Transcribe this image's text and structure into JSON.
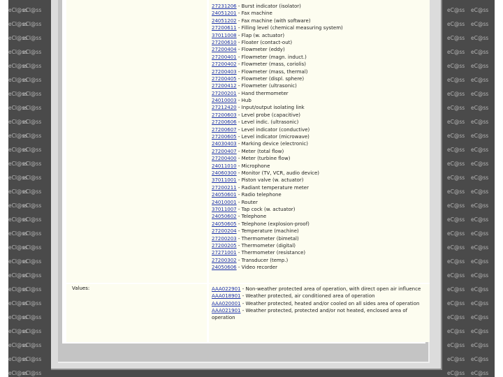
{
  "watermark_left": "eCl@ss",
  "watermark_right": "eC@ss",
  "colors": {
    "background": "#4a4a4a",
    "link": "#1a2fa8",
    "cell": "#fdfdf0"
  },
  "table": {
    "values_label": "Values:",
    "objects": [
      {
        "code": "27231206",
        "text": "Burst indicator (isolator)"
      },
      {
        "code": "24051201",
        "text": "Fax machine"
      },
      {
        "code": "24051202",
        "text": "Fax machine (with software)"
      },
      {
        "code": "27200611",
        "text": "Filling level (chemical measuring system)"
      },
      {
        "code": "37011008",
        "text": "Flap (w. actuator)"
      },
      {
        "code": "27200610",
        "text": "Floater (contact-out)"
      },
      {
        "code": "27200404",
        "text": "Flowmeter (eddy)"
      },
      {
        "code": "27200401",
        "text": "Flowmeter (magn. induct.)"
      },
      {
        "code": "27200402",
        "text": "Flowmeter (mass, coriolis)"
      },
      {
        "code": "27200403",
        "text": "Flowmeter (mass, thermal)"
      },
      {
        "code": "27200405",
        "text": "Flowmeter (displ. sphere)"
      },
      {
        "code": "27200412",
        "text": "Flowmeter (ultrasonic)"
      },
      {
        "code": "27200201",
        "text": "Hand thermometer"
      },
      {
        "code": "24010003",
        "text": "Hub"
      },
      {
        "code": "27212420",
        "text": "Input/output isolating link"
      },
      {
        "code": "27200603",
        "text": "Level probe (capacitive)"
      },
      {
        "code": "27200606",
        "text": "Level indic. (ultrasonic)"
      },
      {
        "code": "27200607",
        "text": "Level indicator (conductive)"
      },
      {
        "code": "27200605",
        "text": "Level indicator (microwave)"
      },
      {
        "code": "24030403",
        "text": "Marking device (electronic)"
      },
      {
        "code": "27200407",
        "text": "Meter (total flow)"
      },
      {
        "code": "27200400",
        "text": "Meter (turbine flow)"
      },
      {
        "code": "24011010",
        "text": "Microphone"
      },
      {
        "code": "24060300",
        "text": "Monitor (TV, VCR, audio device)"
      },
      {
        "code": "37011001",
        "text": "Piston valve (w. actuator)"
      },
      {
        "code": "27200211",
        "text": "Radiant temperature meter"
      },
      {
        "code": "24050601",
        "text": "Radio telephone"
      },
      {
        "code": "24010001",
        "text": "Router"
      },
      {
        "code": "37011007",
        "text": "Tap cock (w. actuator)"
      },
      {
        "code": "24050602",
        "text": "Telephone"
      },
      {
        "code": "24050605",
        "text": "Telephone (explosion-proof)"
      },
      {
        "code": "27200204",
        "text": "Temperature (machine)"
      },
      {
        "code": "27200203",
        "text": "Thermometer (bimetal)"
      },
      {
        "code": "27200205",
        "text": "Thermometer (digital)"
      },
      {
        "code": "27271001",
        "text": "Thermometer (resistance)"
      },
      {
        "code": "27200302",
        "text": "Transducer (temp.)"
      },
      {
        "code": "24050606",
        "text": "Video recorder"
      }
    ],
    "values": [
      {
        "code": "AAA022901",
        "text": "Non-weather protected area of operation, with direct open air influence"
      },
      {
        "code": "AAA018901",
        "text": "Weather protected, air conditioned area of operation"
      },
      {
        "code": "AAA020001",
        "text": "Weather protected, heated and/or cooled on all sides area of operation"
      },
      {
        "code": "AAA021901",
        "text": "Weather protected, protected and/or not heated, enclosed area of operation"
      }
    ]
  }
}
